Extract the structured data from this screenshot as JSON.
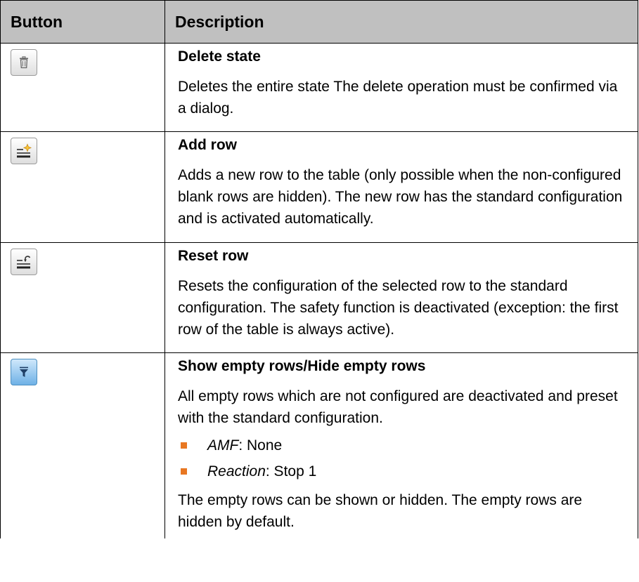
{
  "table": {
    "headers": {
      "button": "Button",
      "description": "Description"
    },
    "rows": [
      {
        "icon": "trash-icon",
        "title": "Delete state",
        "text": "Deletes the entire state The delete operation must be confirmed via a dialog."
      },
      {
        "icon": "add-row-icon",
        "title": "Add row",
        "text": "Adds a new row to the table (only possible when the non-configured blank rows are hidden). The new row has the standard configuration and is activated automatically."
      },
      {
        "icon": "reset-row-icon",
        "title": "Reset row",
        "text": "Resets the configuration of the selected row to the standard configuration. The safety function is deactivated (exception: the first row of the table is always active)."
      },
      {
        "icon": "filter-icon",
        "title": "Show empty rows/Hide empty rows",
        "text": "All empty rows which are not configured are deactivated and preset with the standard configuration.",
        "bullets": [
          {
            "term": "AMF",
            "value": ": None"
          },
          {
            "term": "Reaction",
            "value": ": Stop 1"
          }
        ],
        "text2": "The empty rows can be shown or hidden. The empty rows are hidden by default."
      }
    ]
  },
  "colors": {
    "header_bg": "#c0c0c0",
    "bullet": "#e87722",
    "filter_button": "#6fb1e6"
  }
}
